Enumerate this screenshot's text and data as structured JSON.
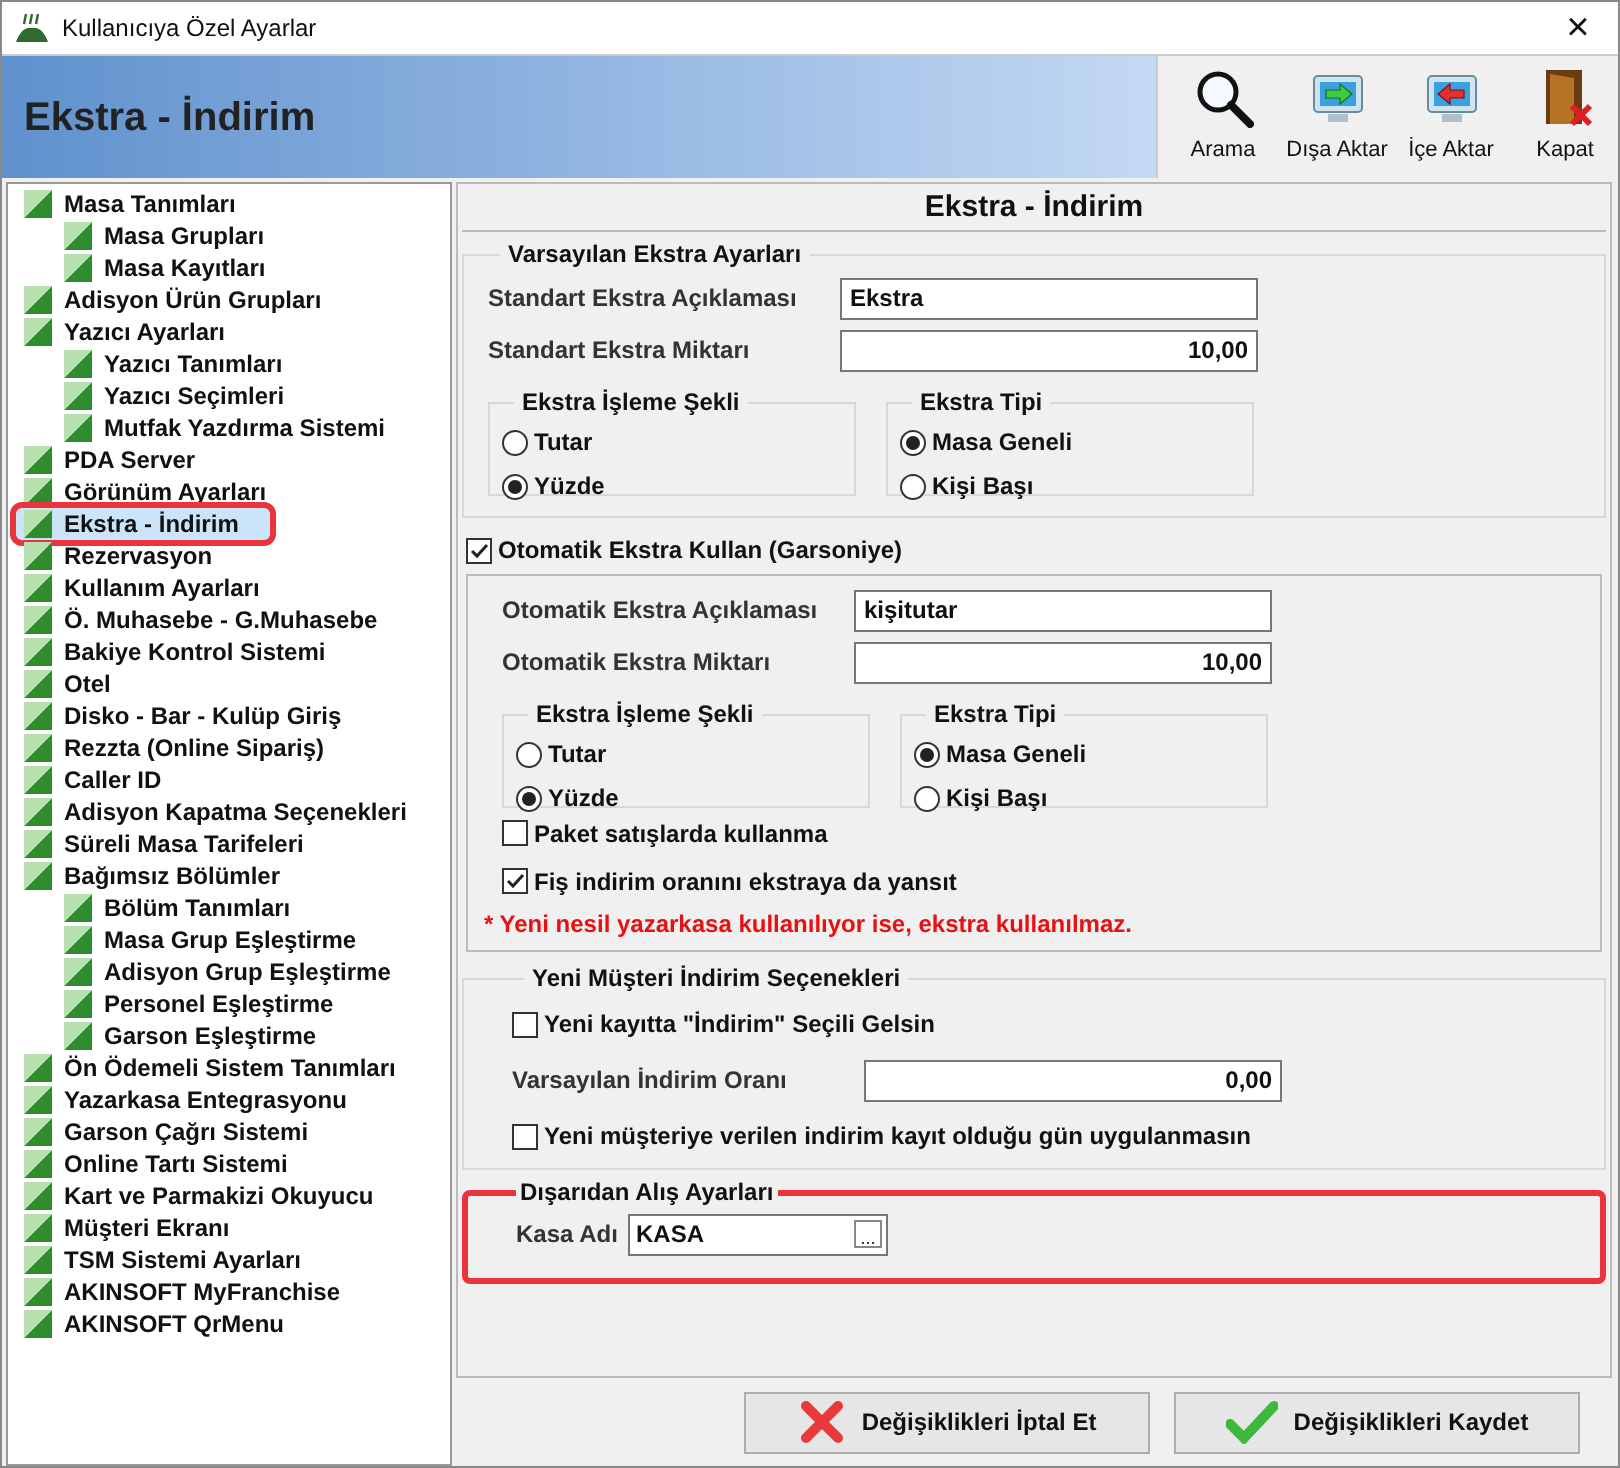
{
  "window": {
    "title": "Kullanıcıya Özel Ayarlar",
    "close": "×"
  },
  "header": {
    "title": "Ekstra - İndirim"
  },
  "toolbar": [
    {
      "label": "Arama",
      "kind": "search"
    },
    {
      "label": "Dışa Aktar",
      "kind": "export"
    },
    {
      "label": "İçe Aktar",
      "kind": "import"
    },
    {
      "label": "Kapat",
      "kind": "close"
    }
  ],
  "tree": [
    {
      "label": "Masa Tanımları",
      "selected": false,
      "highlighted": false,
      "children": [
        {
          "label": "Masa Grupları",
          "selected": false,
          "highlighted": false
        },
        {
          "label": "Masa Kayıtları",
          "selected": false,
          "highlighted": false
        }
      ]
    },
    {
      "label": "Adisyon Ürün Grupları",
      "selected": false,
      "highlighted": false
    },
    {
      "label": "Yazıcı Ayarları",
      "selected": false,
      "highlighted": false,
      "children": [
        {
          "label": "Yazıcı Tanımları",
          "selected": false,
          "highlighted": false
        },
        {
          "label": "Yazıcı Seçimleri",
          "selected": false,
          "highlighted": false
        },
        {
          "label": "Mutfak Yazdırma Sistemi",
          "selected": false,
          "highlighted": false
        }
      ]
    },
    {
      "label": "PDA Server",
      "selected": false,
      "highlighted": false
    },
    {
      "label": "Görünüm Ayarları",
      "selected": false,
      "highlighted": false
    },
    {
      "label": "Ekstra - İndirim",
      "selected": true,
      "highlighted": true
    },
    {
      "label": "Rezervasyon",
      "selected": false,
      "highlighted": false
    },
    {
      "label": "Kullanım Ayarları",
      "selected": false,
      "highlighted": false
    },
    {
      "label": "Ö. Muhasebe - G.Muhasebe",
      "selected": false,
      "highlighted": false
    },
    {
      "label": "Bakiye Kontrol Sistemi",
      "selected": false,
      "highlighted": false
    },
    {
      "label": "Otel",
      "selected": false,
      "highlighted": false
    },
    {
      "label": "Disko - Bar - Kulüp Giriş",
      "selected": false,
      "highlighted": false
    },
    {
      "label": "Rezzta (Online Sipariş)",
      "selected": false,
      "highlighted": false
    },
    {
      "label": "Caller ID",
      "selected": false,
      "highlighted": false
    },
    {
      "label": "Adisyon Kapatma Seçenekleri",
      "selected": false,
      "highlighted": false
    },
    {
      "label": "Süreli Masa Tarifeleri",
      "selected": false,
      "highlighted": false
    },
    {
      "label": "Bağımsız Bölümler",
      "selected": false,
      "highlighted": false,
      "children": [
        {
          "label": "Bölüm Tanımları",
          "selected": false,
          "highlighted": false
        },
        {
          "label": "Masa Grup Eşleştirme",
          "selected": false,
          "highlighted": false
        },
        {
          "label": "Adisyon Grup Eşleştirme",
          "selected": false,
          "highlighted": false
        },
        {
          "label": "Personel Eşleştirme",
          "selected": false,
          "highlighted": false
        },
        {
          "label": "Garson Eşleştirme",
          "selected": false,
          "highlighted": false
        }
      ]
    },
    {
      "label": "Ön Ödemeli Sistem Tanımları",
      "selected": false,
      "highlighted": false
    },
    {
      "label": "Yazarkasa Entegrasyonu",
      "selected": false,
      "highlighted": false
    },
    {
      "label": "Garson Çağrı Sistemi",
      "selected": false,
      "highlighted": false
    },
    {
      "label": "Online Tartı Sistemi",
      "selected": false,
      "highlighted": false
    },
    {
      "label": "Kart ve Parmakizi Okuyucu",
      "selected": false,
      "highlighted": false
    },
    {
      "label": "Müşteri Ekranı",
      "selected": false,
      "highlighted": false
    },
    {
      "label": "TSM Sistemi Ayarları",
      "selected": false,
      "highlighted": false
    },
    {
      "label": "AKINSOFT MyFranchise",
      "selected": false,
      "highlighted": false
    },
    {
      "label": "AKINSOFT QrMenu",
      "selected": false,
      "highlighted": false
    }
  ],
  "panel": {
    "title": "Ekstra - İndirim",
    "default_extra": {
      "title": "Varsayılan Ekstra Ayarları",
      "fields": [
        {
          "label": "Standart Ekstra Açıklaması",
          "value": "Ekstra",
          "kind": "text"
        },
        {
          "label": "Standart Ekstra Miktarı",
          "value": "10,00",
          "kind": "number"
        }
      ],
      "groups": [
        {
          "title": "Ekstra İşleme Şekli",
          "options": [
            {
              "label": "Tutar",
              "selected": false
            },
            {
              "label": "Yüzde",
              "selected": true
            }
          ]
        },
        {
          "title": "Ekstra Tipi",
          "options": [
            {
              "label": "Masa Geneli",
              "selected": true
            },
            {
              "label": "Kişi Başı",
              "selected": false
            }
          ]
        }
      ]
    },
    "auto_extra": {
      "label": "Otomatik Ekstra Kullan (Garsoniye)",
      "checked": true,
      "fields": [
        {
          "label": "Otomatik Ekstra Açıklaması",
          "value": "kişitutar",
          "kind": "text"
        },
        {
          "label": "Otomatik Ekstra Miktarı",
          "value": "10,00",
          "kind": "number"
        }
      ],
      "groups": [
        {
          "title": "Ekstra İşleme Şekli",
          "options": [
            {
              "label": "Tutar",
              "selected": false
            },
            {
              "label": "Yüzde",
              "selected": true
            }
          ]
        },
        {
          "title": "Ekstra Tipi",
          "options": [
            {
              "label": "Masa Geneli",
              "selected": true
            },
            {
              "label": "Kişi Başı",
              "selected": false
            }
          ]
        }
      ],
      "checks": [
        {
          "label": "Paket satışlarda kullanma",
          "checked": false
        },
        {
          "label": "Fiş indirim oranını ekstraya da yansıt",
          "checked": true
        }
      ],
      "note": "* Yeni nesil yazarkasa kullanılıyor ise, ekstra kullanılmaz."
    },
    "new_customer": {
      "title": "Yeni Müşteri İndirim Seçenekleri",
      "items": [
        {
          "kind": "check",
          "label": "Yeni kayıtta \"İndirim\" Seçili Gelsin",
          "checked": false
        },
        {
          "kind": "field",
          "label": "Varsayılan İndirim Oranı",
          "value": "0,00"
        },
        {
          "kind": "check",
          "label": "Yeni müşteriye verilen indirim kayıt olduğu gün uygulanmasın",
          "checked": false
        }
      ]
    },
    "external": {
      "title": "Dışarıdan Alış Ayarları",
      "highlighted": true,
      "label": "Kasa Adı",
      "value": "KASA",
      "browse": "..."
    }
  },
  "buttons": [
    {
      "label": "Değişiklikleri İptal Et",
      "kind": "cancel"
    },
    {
      "label": "Değişiklikleri Kaydet",
      "kind": "save"
    }
  ]
}
